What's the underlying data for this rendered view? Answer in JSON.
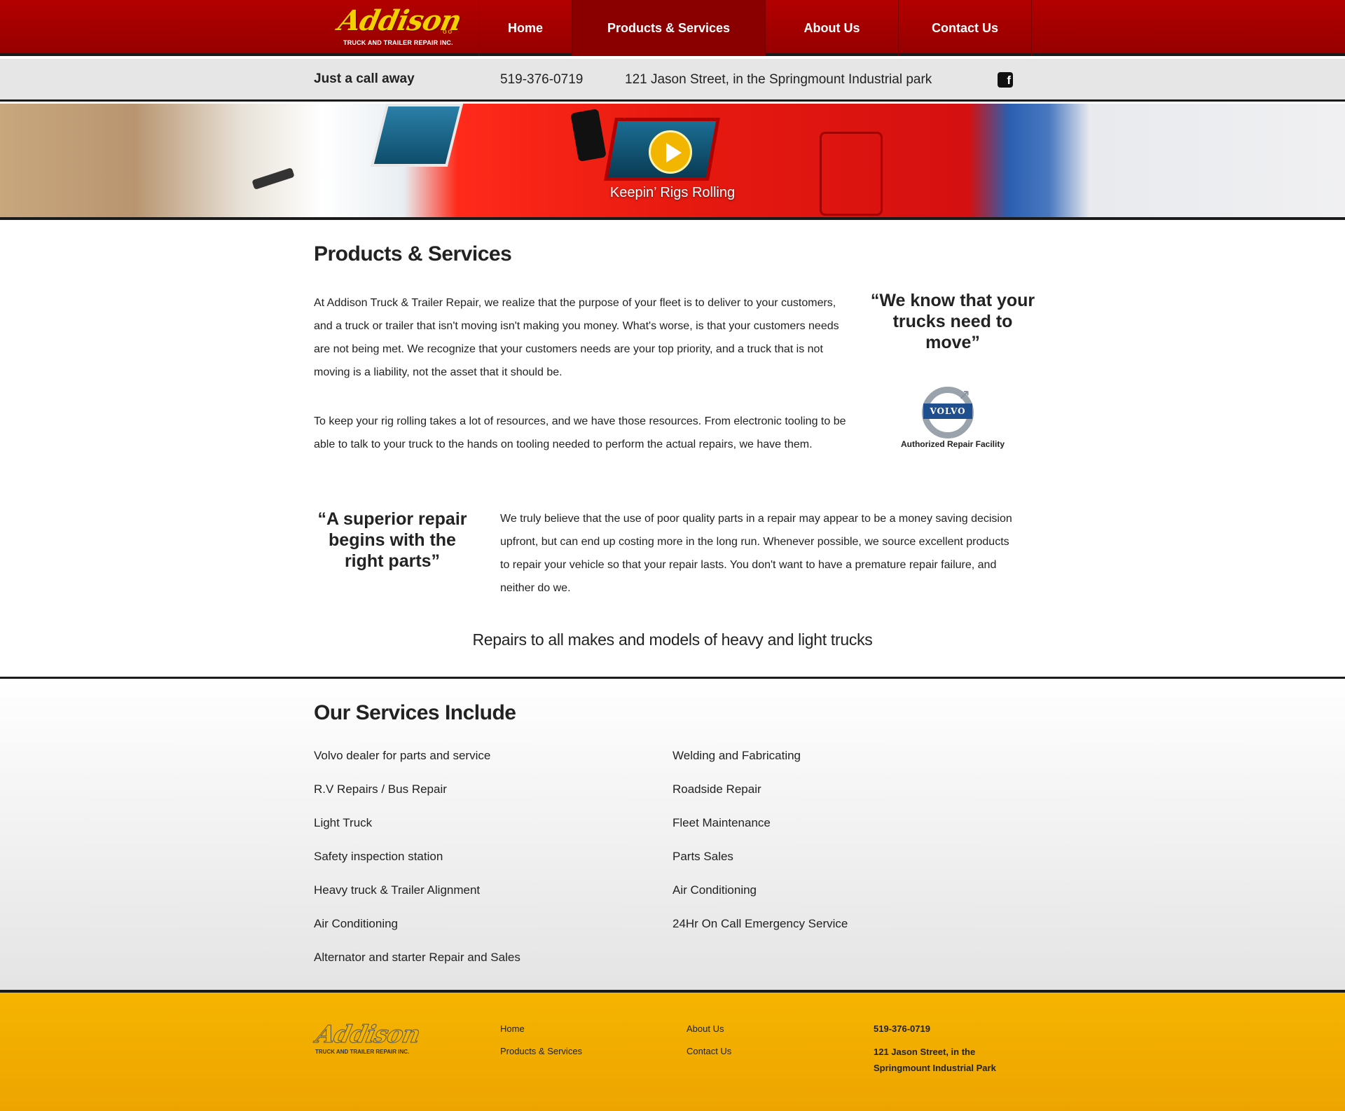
{
  "nav": {
    "logo_text": "Addison",
    "logo_tagline": "TRUCK AND TRAILER REPAIR INC.",
    "items": [
      {
        "label": "Home"
      },
      {
        "label": "Products & Services"
      },
      {
        "label": "About Us"
      },
      {
        "label": "Contact Us"
      }
    ],
    "active_item": "Products & Services"
  },
  "infobar": {
    "call_label": "Just a call away",
    "phone": "519-376-0719",
    "address": "121 Jason Street, in the Springmount Industrial park",
    "social_icon": "facebook-icon"
  },
  "hero": {
    "caption": "Keepin’ Rigs Rolling",
    "play_icon": "play-icon"
  },
  "main": {
    "heading": "Products & Services",
    "paragraph1": "At Addison Truck & Trailer Repair, we realize that the purpose of your fleet is to deliver to your customers, and a truck or trailer that isn't moving isn't making you money. What's worse, is that your customers needs are not being met. We recognize that your customers needs are your top priority, and a truck that is not moving is a liability, not the asset that it should be.",
    "paragraph2": "To keep your rig rolling takes a lot of resources, and we have those resources. From electronic tooling to be able to talk to your truck to the hands on tooling needed to perform the actual repairs, we have them.",
    "quote1": "“We know that your trucks need to move”",
    "volvo_logo_text": "VOLVO",
    "volvo_caption": "Authorized Repair Facility",
    "quote2": "“A superior repair begins with the right parts”",
    "paragraph3": "We truly believe that the use of poor quality parts in a repair may appear to be a money saving decision upfront, but can end up costing more in the long run. Whenever possible, we source excellent products to repair your vehicle so that your repair lasts. You don't want to have a premature repair failure, and neither do we.",
    "tagline": "Repairs to all makes and models of heavy and light trucks"
  },
  "services": {
    "heading": "Our Services Include",
    "left": [
      "Volvo dealer for parts and service",
      "R.V Repairs / Bus Repair",
      "Light Truck",
      "Safety inspection station",
      "Heavy truck & Trailer Alignment",
      "Air Conditioning",
      "Alternator and starter Repair and Sales"
    ],
    "right": [
      "Welding and Fabricating",
      "Roadside Repair",
      "Fleet Maintenance",
      "Parts Sales",
      "Air Conditioning",
      "24Hr On Call Emergency Service"
    ]
  },
  "footer": {
    "logo_text": "Addison",
    "logo_tagline": "TRUCK AND TRAILER REPAIR INC.",
    "links_col1": [
      "Home",
      "Products & Services"
    ],
    "links_col2": [
      "About Us",
      "Contact Us"
    ],
    "phone": "519-376-0719",
    "address_line1": "121 Jason Street, in the",
    "address_line2": "Springmount Industrial Park"
  },
  "colors": {
    "nav_red": "#b30000",
    "accent_gold": "#f3b600",
    "footer_gold": "#f6b500",
    "volvo_blue": "#1f4f8f"
  }
}
